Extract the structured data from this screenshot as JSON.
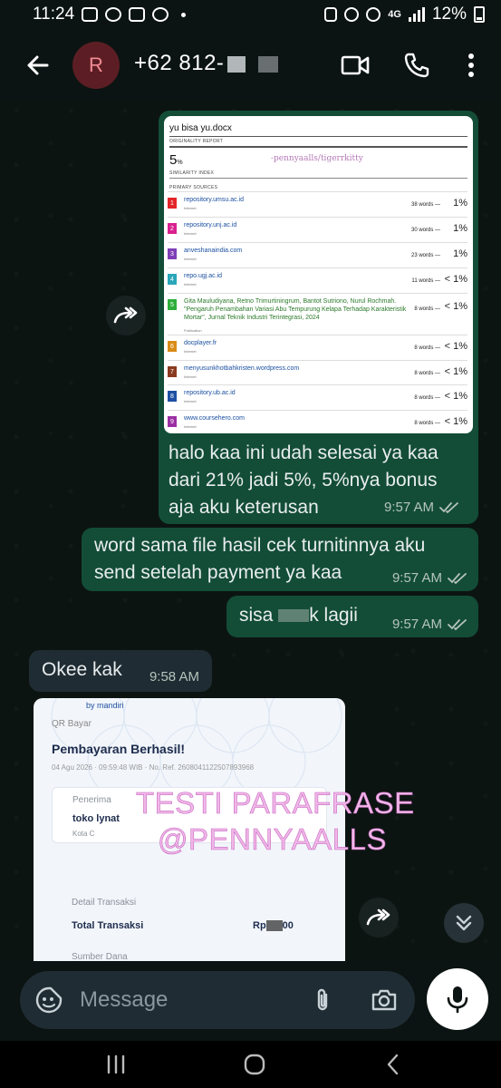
{
  "status": {
    "time": "11:24",
    "network": "4G",
    "battery": "12%"
  },
  "header": {
    "avatar_letter": "R",
    "contact": "+62 812-"
  },
  "doc": {
    "filename": "yu bisa yu.docx",
    "report_label": "ORIGINALITY REPORT",
    "similarity": "5",
    "similarity_unit": "%",
    "similarity_label": "SIMILARITY INDEX",
    "watermark": "-pennyaalls/tigerrkitty",
    "sources_label": "PRIMARY SOURCES",
    "sources": [
      {
        "num": "1",
        "name": "repository.umsu.ac.id",
        "type": "Internet",
        "words": "38 words —",
        "pct": "1%",
        "color": "#e4262b"
      },
      {
        "num": "2",
        "name": "repository.unj.ac.id",
        "type": "Internet",
        "words": "30 words —",
        "pct": "1%",
        "color": "#d9218f"
      },
      {
        "num": "3",
        "name": "anveshanaindia.com",
        "type": "Internet",
        "words": "23 words —",
        "pct": "1%",
        "color": "#7f3fb6"
      },
      {
        "num": "4",
        "name": "repo.ugj.ac.id",
        "type": "Internet",
        "words": "11 words —",
        "pct": "< 1%",
        "color": "#2aa7b9"
      },
      {
        "num": "5",
        "name": "Gita Mauludiyana, Retno Trimurtiningrum, Bantot Sutriono, Nurul Rochmah. \"Pengaruh Penambahan Variasi Abu Tempurung Kelapa Terhadap Karakteristik Mortar\", Jurnal Teknik Industri Terintegrasi, 2024",
        "type": "Publication",
        "words": "8 words —",
        "pct": "< 1%",
        "color": "#2eae3b"
      },
      {
        "num": "6",
        "name": "docplayer.fr",
        "type": "Internet",
        "words": "8 words —",
        "pct": "< 1%",
        "color": "#d98c17"
      },
      {
        "num": "7",
        "name": "menyusunkhotbahkristen.wordpress.com",
        "type": "Internet",
        "words": "8 words —",
        "pct": "< 1%",
        "color": "#8b3a1f"
      },
      {
        "num": "8",
        "name": "repository.ub.ac.id",
        "type": "Internet",
        "words": "8 words —",
        "pct": "< 1%",
        "color": "#1e4fa3"
      },
      {
        "num": "9",
        "name": "www.coursehero.com",
        "type": "Internet",
        "words": "8 words —",
        "pct": "< 1%",
        "color": "#9b2fa3"
      }
    ]
  },
  "messages": {
    "m1_text": "halo kaa ini udah selesai ya kaa dari 21% jadi 5%, 5%nya bonus aja aku keterusan",
    "m1_time": "9:57 AM",
    "m2_text": "word sama file hasil cek turnitinnya aku send setelah payment ya kaa",
    "m2_time": "9:57 AM",
    "m3_text_a": "sisa ",
    "m3_text_b": "k lagii",
    "m3_time": "9:57 AM",
    "m4_text": "Okee kak",
    "m4_time": "9:58 AM"
  },
  "payment": {
    "bank": "by mandiri",
    "qr_label": "QR Bayar",
    "title": "Pembayaran Berhasil!",
    "date": "04 Agu 2026 · 09:59:48 WIB · No. Ref. 2608041122507893968",
    "recipient_label": "Penerima",
    "recipient": "toko lynat",
    "city": "Kota C",
    "detail_label": "Detail Transaksi",
    "total_label": "Total Transaksi",
    "total_a": "Rp",
    "total_b": "00",
    "source_label": "Sumber Dana",
    "overlay_line1": "TESTI PARAFRASE",
    "overlay_line2": "@PENNYAALLS"
  },
  "composer": {
    "placeholder": "Message"
  },
  "colors": {
    "outgoing": "#134d37",
    "incoming": "#1f2c33",
    "background": "#0c1412",
    "overlay_text": "#f0b7e8"
  }
}
